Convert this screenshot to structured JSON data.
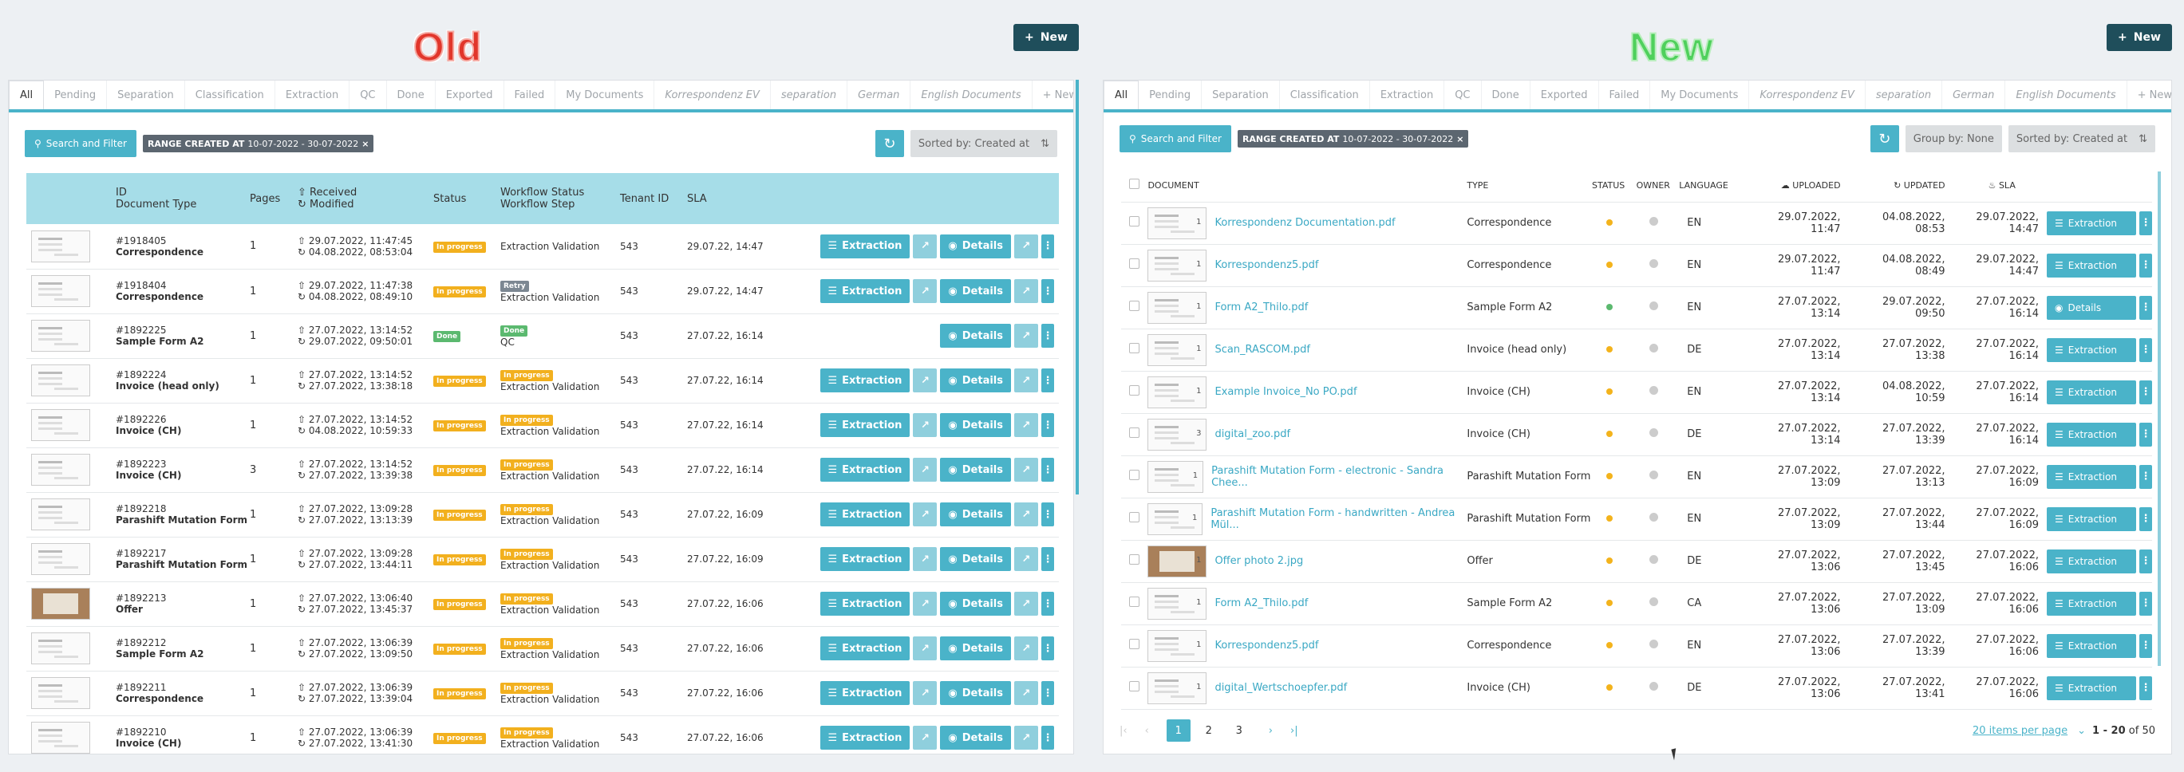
{
  "labels": {
    "old": "Old",
    "new": "New"
  },
  "new_button": "New",
  "tabs": [
    "All",
    "Pending",
    "Separation",
    "Classification",
    "Extraction",
    "QC",
    "Done",
    "Exported",
    "Failed",
    "My Documents",
    "Korrespondenz EV",
    "separation",
    "German",
    "English Documents",
    "+ New"
  ],
  "toolbar": {
    "search": "Search and Filter",
    "range_label": "RANGE CREATED AT",
    "range_value": "10-07-2022 - 30-07-2022",
    "sort": "Sorted by: Created at",
    "group": "Group by: None"
  },
  "old": {
    "headers": {
      "id": "ID",
      "doctype": "Document Type",
      "pages": "Pages",
      "received": "Received",
      "modified": "Modified",
      "status": "Status",
      "wf_status": "Workflow Status",
      "wf_step": "Workflow Step",
      "tenant": "Tenant ID",
      "sla": "SLA"
    },
    "actions": {
      "extraction": "Extraction",
      "details": "Details"
    },
    "rows": [
      {
        "id": "#1918405",
        "type": "Correspondence",
        "pages": "1",
        "received": "29.07.2022, 11:47:45",
        "modified": "04.08.2022, 08:53:04",
        "status": "In progress",
        "wf_badge": "",
        "wf_step": "Extraction Validation",
        "tenant": "543",
        "sla": "29.07.22, 14:47",
        "extract": true,
        "thumb": "doc"
      },
      {
        "id": "#1918404",
        "type": "Correspondence",
        "pages": "1",
        "received": "29.07.2022, 11:47:38",
        "modified": "04.08.2022, 08:49:10",
        "status": "In progress",
        "wf_badge": "Retry",
        "wf_step": "Extraction Validation",
        "tenant": "543",
        "sla": "29.07.22, 14:47",
        "extract": true,
        "thumb": "doc"
      },
      {
        "id": "#1892225",
        "type": "Sample Form A2",
        "pages": "1",
        "received": "27.07.2022, 13:14:52",
        "modified": "29.07.2022, 09:50:01",
        "status": "Done",
        "wf_badge": "Done",
        "wf_step": "QC",
        "tenant": "543",
        "sla": "27.07.22, 16:14",
        "extract": false,
        "thumb": "doc"
      },
      {
        "id": "#1892224",
        "type": "Invoice (head only)",
        "pages": "1",
        "received": "27.07.2022, 13:14:52",
        "modified": "27.07.2022, 13:38:18",
        "status": "In progress",
        "wf_badge": "In progress",
        "wf_step": "Extraction Validation",
        "tenant": "543",
        "sla": "27.07.22, 16:14",
        "extract": true,
        "thumb": "doc"
      },
      {
        "id": "#1892226",
        "type": "Invoice (CH)",
        "pages": "1",
        "received": "27.07.2022, 13:14:52",
        "modified": "04.08.2022, 10:59:33",
        "status": "In progress",
        "wf_badge": "In progress",
        "wf_step": "Extraction Validation",
        "tenant": "543",
        "sla": "27.07.22, 16:14",
        "extract": true,
        "thumb": "doc"
      },
      {
        "id": "#1892223",
        "type": "Invoice (CH)",
        "pages": "3",
        "received": "27.07.2022, 13:14:52",
        "modified": "27.07.2022, 13:39:38",
        "status": "In progress",
        "wf_badge": "In progress",
        "wf_step": "Extraction Validation",
        "tenant": "543",
        "sla": "27.07.22, 16:14",
        "extract": true,
        "thumb": "doc"
      },
      {
        "id": "#1892218",
        "type": "Parashift Mutation Form",
        "pages": "1",
        "received": "27.07.2022, 13:09:28",
        "modified": "27.07.2022, 13:13:39",
        "status": "In progress",
        "wf_badge": "In progress",
        "wf_step": "Extraction Validation",
        "tenant": "543",
        "sla": "27.07.22, 16:09",
        "extract": true,
        "thumb": "doc"
      },
      {
        "id": "#1892217",
        "type": "Parashift Mutation Form",
        "pages": "1",
        "received": "27.07.2022, 13:09:28",
        "modified": "27.07.2022, 13:44:11",
        "status": "In progress",
        "wf_badge": "In progress",
        "wf_step": "Extraction Validation",
        "tenant": "543",
        "sla": "27.07.22, 16:09",
        "extract": true,
        "thumb": "doc"
      },
      {
        "id": "#1892213",
        "type": "Offer",
        "pages": "1",
        "received": "27.07.2022, 13:06:40",
        "modified": "27.07.2022, 13:45:37",
        "status": "In progress",
        "wf_badge": "In progress",
        "wf_step": "Extraction Validation",
        "tenant": "543",
        "sla": "27.07.22, 16:06",
        "extract": true,
        "thumb": "photo"
      },
      {
        "id": "#1892212",
        "type": "Sample Form A2",
        "pages": "1",
        "received": "27.07.2022, 13:06:39",
        "modified": "27.07.2022, 13:09:50",
        "status": "In progress",
        "wf_badge": "In progress",
        "wf_step": "Extraction Validation",
        "tenant": "543",
        "sla": "27.07.22, 16:06",
        "extract": true,
        "thumb": "doc"
      },
      {
        "id": "#1892211",
        "type": "Correspondence",
        "pages": "1",
        "received": "27.07.2022, 13:06:39",
        "modified": "27.07.2022, 13:39:04",
        "status": "In progress",
        "wf_badge": "In progress",
        "wf_step": "Extraction Validation",
        "tenant": "543",
        "sla": "27.07.22, 16:06",
        "extract": true,
        "thumb": "doc"
      },
      {
        "id": "#1892210",
        "type": "Invoice (CH)",
        "pages": "1",
        "received": "27.07.2022, 13:06:39",
        "modified": "27.07.2022, 13:41:30",
        "status": "In progress",
        "wf_badge": "In progress",
        "wf_step": "Extraction Validation",
        "tenant": "543",
        "sla": "27.07.22, 16:06",
        "extract": true,
        "thumb": "doc"
      }
    ]
  },
  "new": {
    "headers": {
      "document": "DOCUMENT",
      "type": "TYPE",
      "status": "STATUS",
      "owner": "OWNER",
      "language": "LANGUAGE",
      "uploaded": "UPLOADED",
      "updated": "UPDATED",
      "sla": "SLA"
    },
    "actions": {
      "extraction": "Extraction",
      "details": "Details"
    },
    "rows": [
      {
        "name": "Korrespondenz Documentation.pdf",
        "pages": "1",
        "type": "Correspondence",
        "status": "yellow",
        "lang": "EN",
        "uploaded": "29.07.2022, 11:47",
        "updated": "04.08.2022, 08:53",
        "sla": "29.07.2022, 14:47",
        "action": "Extraction",
        "thumb": "doc"
      },
      {
        "name": "Korrespondenz5.pdf",
        "pages": "1",
        "type": "Correspondence",
        "status": "yellow",
        "lang": "EN",
        "uploaded": "29.07.2022, 11:47",
        "updated": "04.08.2022, 08:49",
        "sla": "29.07.2022, 14:47",
        "action": "Extraction",
        "thumb": "doc"
      },
      {
        "name": "Form A2_Thilo.pdf",
        "pages": "1",
        "type": "Sample Form A2",
        "status": "green",
        "lang": "EN",
        "uploaded": "27.07.2022, 13:14",
        "updated": "29.07.2022, 09:50",
        "sla": "27.07.2022, 16:14",
        "action": "Details",
        "thumb": "doc"
      },
      {
        "name": "Scan_RASCOM.pdf",
        "pages": "1",
        "type": "Invoice (head only)",
        "status": "yellow",
        "lang": "DE",
        "uploaded": "27.07.2022, 13:14",
        "updated": "27.07.2022, 13:38",
        "sla": "27.07.2022, 16:14",
        "action": "Extraction",
        "thumb": "doc"
      },
      {
        "name": "Example Invoice_No PO.pdf",
        "pages": "1",
        "type": "Invoice (CH)",
        "status": "yellow",
        "lang": "EN",
        "uploaded": "27.07.2022, 13:14",
        "updated": "04.08.2022, 10:59",
        "sla": "27.07.2022, 16:14",
        "action": "Extraction",
        "thumb": "doc"
      },
      {
        "name": "digital_zoo.pdf",
        "pages": "3",
        "type": "Invoice (CH)",
        "status": "yellow",
        "lang": "DE",
        "uploaded": "27.07.2022, 13:14",
        "updated": "27.07.2022, 13:39",
        "sla": "27.07.2022, 16:14",
        "action": "Extraction",
        "thumb": "doc"
      },
      {
        "name": "Parashift Mutation Form - electronic - Sandra Chee...",
        "pages": "1",
        "type": "Parashift Mutation Form",
        "status": "yellow",
        "lang": "EN",
        "uploaded": "27.07.2022, 13:09",
        "updated": "27.07.2022, 13:13",
        "sla": "27.07.2022, 16:09",
        "action": "Extraction",
        "thumb": "doc"
      },
      {
        "name": "Parashift Mutation Form - handwritten - Andrea Mül...",
        "pages": "1",
        "type": "Parashift Mutation Form",
        "status": "yellow",
        "lang": "EN",
        "uploaded": "27.07.2022, 13:09",
        "updated": "27.07.2022, 13:44",
        "sla": "27.07.2022, 16:09",
        "action": "Extraction",
        "thumb": "doc"
      },
      {
        "name": "Offer photo 2.jpg",
        "pages": "1",
        "type": "Offer",
        "status": "yellow",
        "lang": "DE",
        "uploaded": "27.07.2022, 13:06",
        "updated": "27.07.2022, 13:45",
        "sla": "27.07.2022, 16:06",
        "action": "Extraction",
        "thumb": "photo"
      },
      {
        "name": "Form A2_Thilo.pdf",
        "pages": "1",
        "type": "Sample Form A2",
        "status": "yellow",
        "lang": "CA",
        "uploaded": "27.07.2022, 13:06",
        "updated": "27.07.2022, 13:09",
        "sla": "27.07.2022, 16:06",
        "action": "Extraction",
        "thumb": "doc"
      },
      {
        "name": "Korrespondenz5.pdf",
        "pages": "1",
        "type": "Correspondence",
        "status": "yellow",
        "lang": "EN",
        "uploaded": "27.07.2022, 13:06",
        "updated": "27.07.2022, 13:39",
        "sla": "27.07.2022, 16:06",
        "action": "Extraction",
        "thumb": "doc"
      },
      {
        "name": "digital_Wertschoepfer.pdf",
        "pages": "1",
        "type": "Invoice (CH)",
        "status": "yellow",
        "lang": "DE",
        "uploaded": "27.07.2022, 13:06",
        "updated": "27.07.2022, 13:41",
        "sla": "27.07.2022, 16:06",
        "action": "Extraction",
        "thumb": "doc"
      }
    ],
    "pager": {
      "pages": [
        "1",
        "2",
        "3"
      ],
      "current": "1",
      "per_page": "20 items per page",
      "range": "1 - 20",
      "of": "of 50"
    }
  },
  "colors": {
    "accent": "#4ab3c9",
    "header": "#a6dde8",
    "dark": "#1f4e5b",
    "warn": "#f2b01e",
    "done": "#5bb96f"
  }
}
